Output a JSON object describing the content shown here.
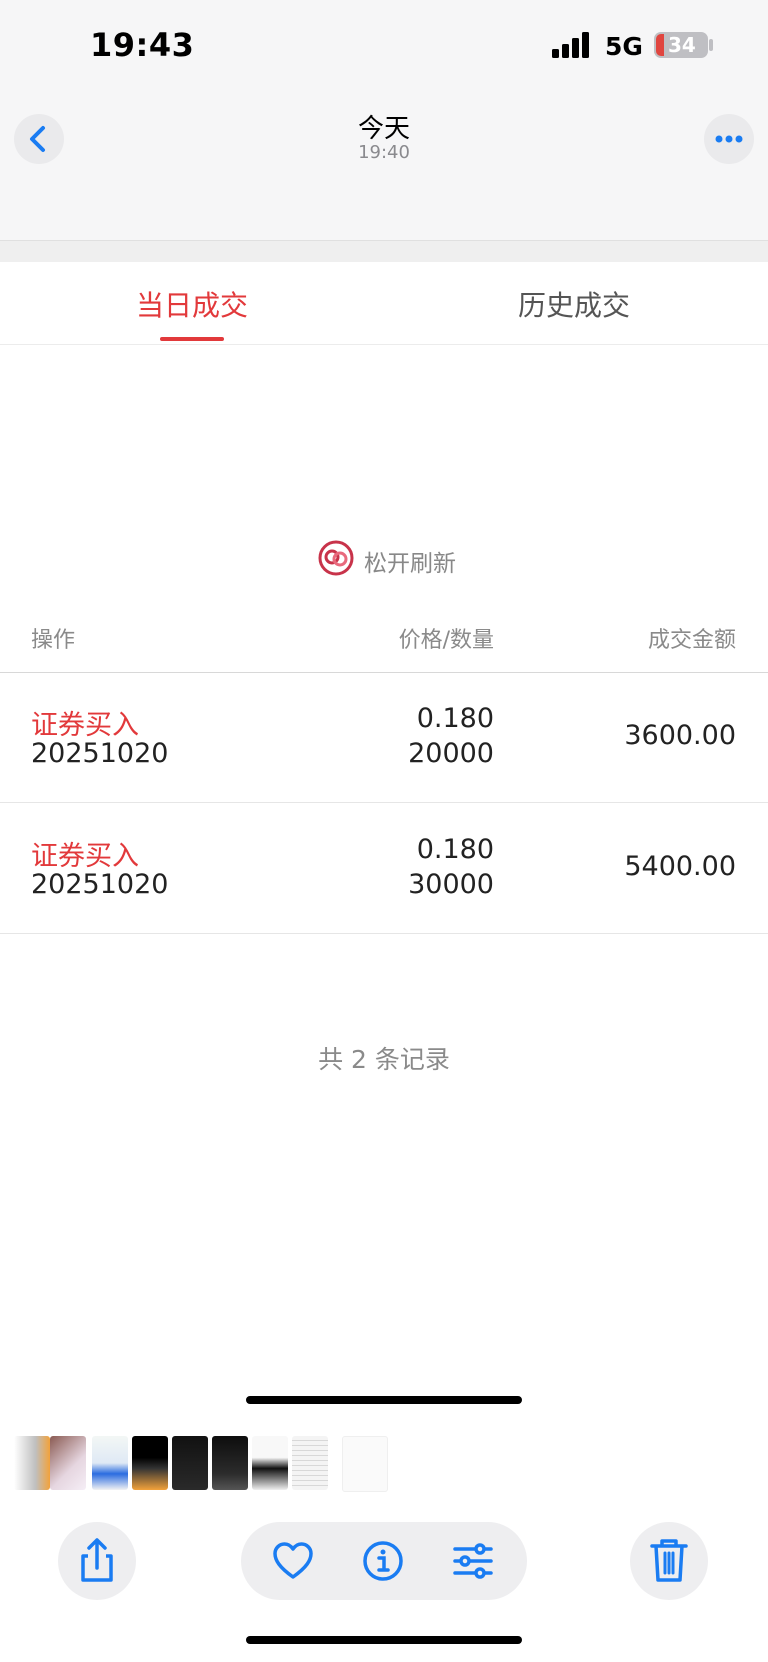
{
  "status_bar": {
    "time": "19:43",
    "network": "5G",
    "battery": "34"
  },
  "nav": {
    "title": "今天",
    "subtitle": "19:40",
    "back_icon": "chevron-left-icon",
    "more_icon": "ellipsis-icon"
  },
  "tabs": {
    "today": "当日成交",
    "history": "历史成交",
    "active": "today"
  },
  "refresh": {
    "text": "松开刷新",
    "logo_icon": "refresh-logo-icon"
  },
  "table": {
    "headers": {
      "operation": "操作",
      "price_qty": "价格/数量",
      "amount": "成交金额"
    },
    "rows": [
      {
        "operation": "证券买入",
        "date": "20251020",
        "price": "0.180",
        "quantity": "20000",
        "amount": "3600.00"
      },
      {
        "operation": "证券买入",
        "date": "20251020",
        "price": "0.180",
        "quantity": "30000",
        "amount": "5400.00"
      }
    ]
  },
  "summary": {
    "total_text": "共 2 条记录"
  },
  "toolbar": {
    "share_icon": "share-icon",
    "heart_icon": "heart-icon",
    "info_icon": "info-icon",
    "adjust_icon": "adjust-icon",
    "trash_icon": "trash-icon"
  },
  "colors": {
    "accent": "#e2393b",
    "ios_blue": "#1a7cf2"
  }
}
